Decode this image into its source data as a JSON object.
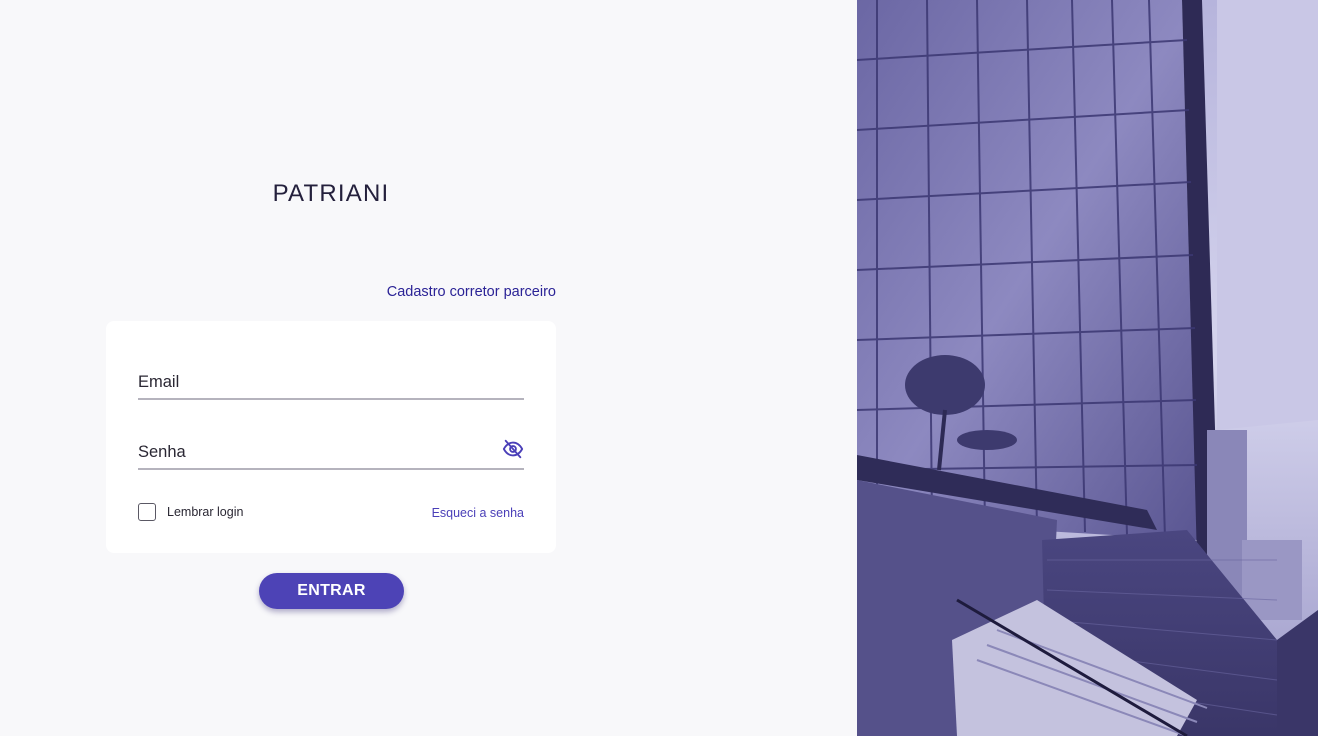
{
  "brand": {
    "logo_text": "PATRIANI"
  },
  "links": {
    "partner_signup": "Cadastro corretor parceiro"
  },
  "form": {
    "email": {
      "placeholder": "Email",
      "value": ""
    },
    "password": {
      "placeholder": "Senha",
      "value": ""
    },
    "remember_label": "Lembrar login",
    "remember_checked": false,
    "forgot_label": "Esqueci a senha",
    "submit_label": "ENTRAR"
  },
  "icons": {
    "toggle_password": "eye-off-icon",
    "background": "building-photo"
  },
  "colors": {
    "accent": "#4d43b6",
    "link": "#2b2396",
    "background": "#f8f8fa",
    "photo_tint": "#6f6aa8"
  }
}
